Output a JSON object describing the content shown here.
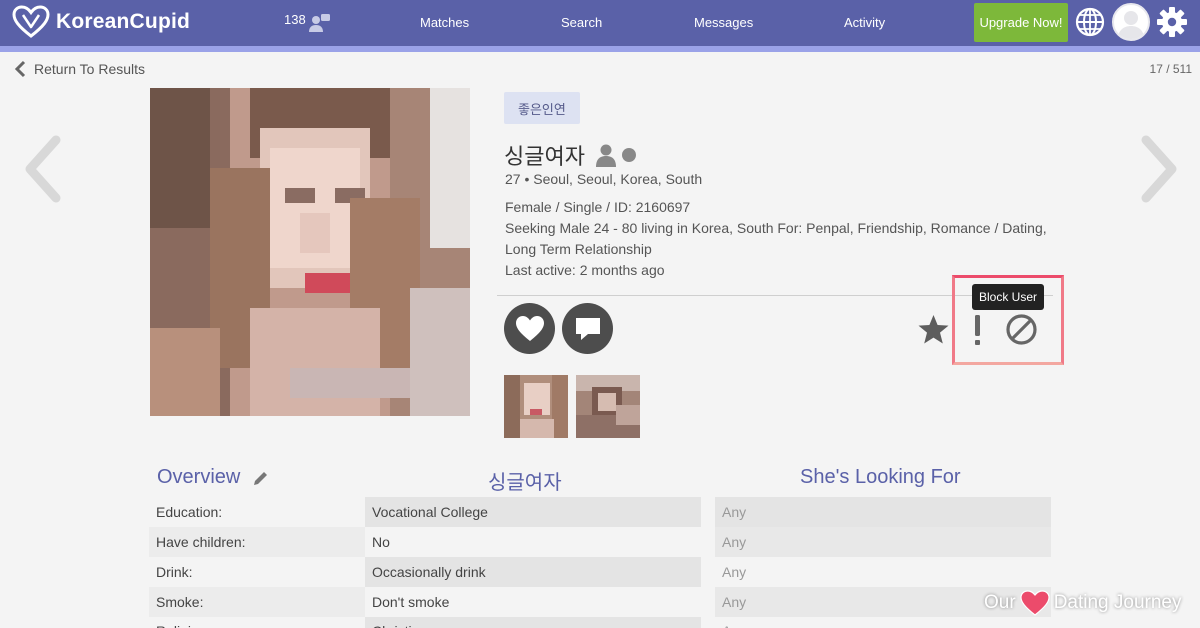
{
  "header": {
    "brand": "KoreanCupid",
    "notification_count": "138",
    "nav": [
      "Matches",
      "Search",
      "Messages",
      "Activity"
    ],
    "upgrade_label": "Upgrade Now!"
  },
  "subheader": {
    "return_label": "Return To Results",
    "pager": "17 / 511"
  },
  "profile": {
    "tagline": "좋은인연",
    "name": "싱글여자",
    "location_line": "27 • Seoul, Seoul, Korea, South",
    "details_line": "Female / Single / ID: 2160697",
    "seeking_line1": "Seeking Male 24 - 80 living in Korea, South For: Penpal, Friendship, Romance / Dating,",
    "seeking_line2": "Long Term Relationship",
    "last_active": "Last active: 2 months ago"
  },
  "actions": {
    "tooltip": "Block User"
  },
  "overview": {
    "title": "Overview",
    "col2_title": "싱글여자",
    "col3_title": "She's Looking For",
    "rows": [
      {
        "label": "Education:",
        "value": "Vocational College",
        "looking": "Any"
      },
      {
        "label": "Have children:",
        "value": "No",
        "looking": "Any"
      },
      {
        "label": "Drink:",
        "value": "Occasionally drink",
        "looking": "Any"
      },
      {
        "label": "Smoke:",
        "value": "Don't smoke",
        "looking": "Any"
      },
      {
        "label": "Religion:",
        "value": "Christian",
        "looking": "Any"
      }
    ]
  },
  "watermark": {
    "part1": "Our",
    "part2": "Dating Journey"
  },
  "colors": {
    "nav_bg": "#5a61a8",
    "accent_green": "#7db83a",
    "highlight": "#ec4b6b"
  }
}
